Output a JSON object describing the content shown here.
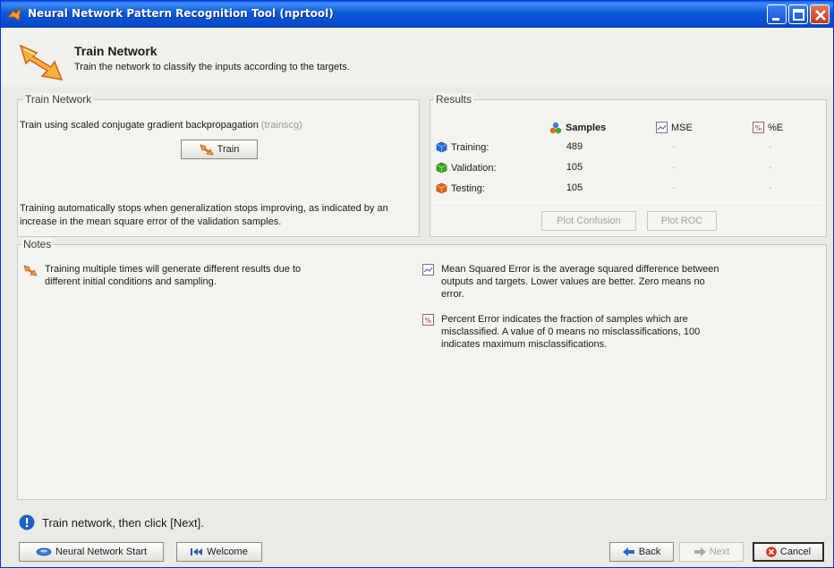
{
  "window": {
    "title": "Neural Network Pattern Recognition Tool (nprtool)"
  },
  "header": {
    "title": "Train Network",
    "subtitle": "Train the network to classify the inputs according to the targets."
  },
  "train_panel": {
    "title": "Train Network",
    "method_label": "Train using scaled conjugate gradient backpropagation",
    "method_fn": "(trainscg)",
    "train_button": "Train",
    "stop_text": "Training automatically stops when generalization stops improving, as indicated by an increase in the mean square error of the validation samples."
  },
  "results": {
    "title": "Results",
    "columns": {
      "samples": "Samples",
      "mse": "MSE",
      "pe": "%E"
    },
    "rows": [
      {
        "label": "Training:",
        "samples": "489",
        "mse": "-",
        "pe": "-",
        "color": "#1f6fd6"
      },
      {
        "label": "Validation:",
        "samples": "105",
        "mse": "-",
        "pe": "-",
        "color": "#37a818"
      },
      {
        "label": "Testing:",
        "samples": "105",
        "mse": "-",
        "pe": "-",
        "color": "#e0651a"
      }
    ],
    "plot_confusion": "Plot Confusion",
    "plot_roc": "Plot ROC"
  },
  "notes": {
    "title": "Notes",
    "items": [
      {
        "icon": "train-arrow-icon",
        "text": "Training multiple times will generate different results due to different initial conditions and sampling."
      },
      {
        "icon": "mse-icon",
        "text": "Mean Squared Error is the average squared difference between outputs and targets. Lower values are better. Zero means no error."
      },
      {
        "icon": "percent-error-icon",
        "text": "Percent Error  indicates the fraction of samples which are misclassified. A value of 0 means no misclassifications, 100 indicates maximum misclassifications."
      }
    ]
  },
  "status": {
    "text": "Train network, then click [Next]."
  },
  "footer": {
    "nn_start": "Neural Network Start",
    "welcome": "Welcome",
    "back": "Back",
    "next": "Next",
    "cancel": "Cancel"
  },
  "colors": {
    "titlebar": "#0a58d8",
    "accent_orange": "#f08a1a",
    "info_blue": "#1f5fc8"
  }
}
